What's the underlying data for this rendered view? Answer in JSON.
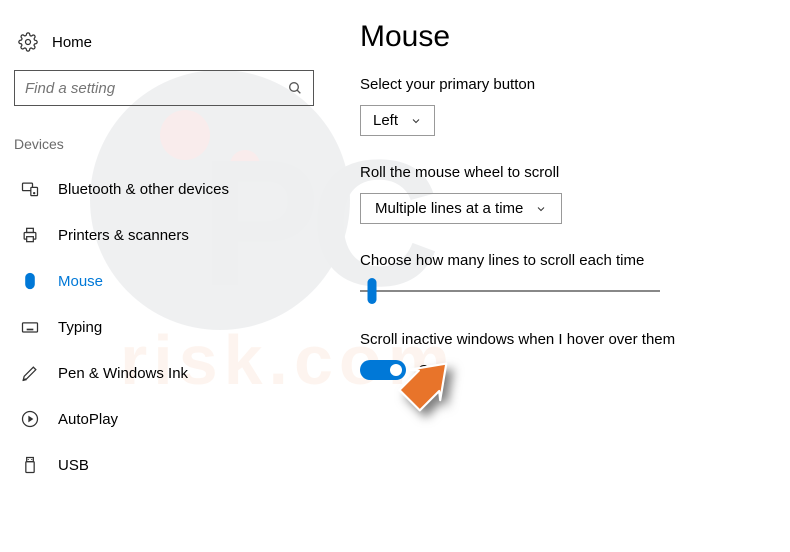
{
  "header": {
    "home_label": "Home"
  },
  "search": {
    "placeholder": "Find a setting"
  },
  "sidebar": {
    "category": "Devices",
    "items": [
      {
        "label": "Bluetooth & other devices"
      },
      {
        "label": "Printers & scanners"
      },
      {
        "label": "Mouse"
      },
      {
        "label": "Typing"
      },
      {
        "label": "Pen & Windows Ink"
      },
      {
        "label": "AutoPlay"
      },
      {
        "label": "USB"
      }
    ]
  },
  "main": {
    "title": "Mouse",
    "primary_button_label": "Select your primary button",
    "primary_button_value": "Left",
    "wheel_label": "Roll the mouse wheel to scroll",
    "wheel_value": "Multiple lines at a time",
    "lines_label": "Choose how many lines to scroll each time",
    "inactive_label": "Scroll inactive windows when I hover over them",
    "inactive_toggle_state": "On"
  }
}
